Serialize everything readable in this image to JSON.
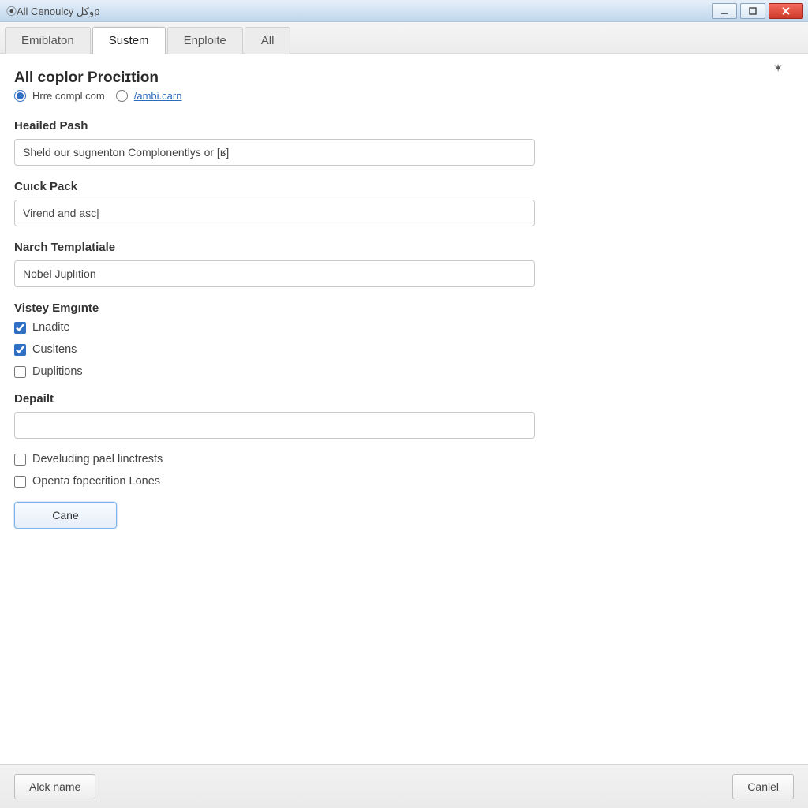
{
  "window": {
    "title": "⦿All Cenoulcy وكلp"
  },
  "tabs": [
    {
      "label": "Emiblaton",
      "active": false
    },
    {
      "label": "Sustem",
      "active": true
    },
    {
      "label": "Enploite",
      "active": false
    },
    {
      "label": "All",
      "active": false
    }
  ],
  "page": {
    "title": "All coplor Prociɪtion",
    "radio1_label": "Hrre compl.com",
    "radio2_label": "/ambi.carn",
    "close_icon": "✶"
  },
  "fields": {
    "heailed_pash": {
      "label": "Heailed Pash",
      "value": "Sheld our sugnenton Complonentlys or [ʁ]"
    },
    "cuick_pack": {
      "label": "Cuıck Pack",
      "value": "Virend and asc|"
    },
    "narch_templatiale": {
      "label": "Narch Templatiale",
      "value": "Nobel Juplıtion"
    },
    "vistey_emgnte": {
      "label": "Vistey Emgınte"
    },
    "depailt": {
      "label": "Depailt",
      "value": ""
    }
  },
  "vistey_checks": [
    {
      "label": "Lnadite",
      "checked": true
    },
    {
      "label": "Cusltens",
      "checked": true
    },
    {
      "label": "Duplitions",
      "checked": false
    }
  ],
  "extra_checks": [
    {
      "label": "Develuding pael linctrests",
      "checked": false
    },
    {
      "label": "Openta ƭopecrition Lones",
      "checked": false
    }
  ],
  "buttons": {
    "primary": "Cane",
    "footer_left": "Alck name",
    "footer_right": "Caniel"
  }
}
